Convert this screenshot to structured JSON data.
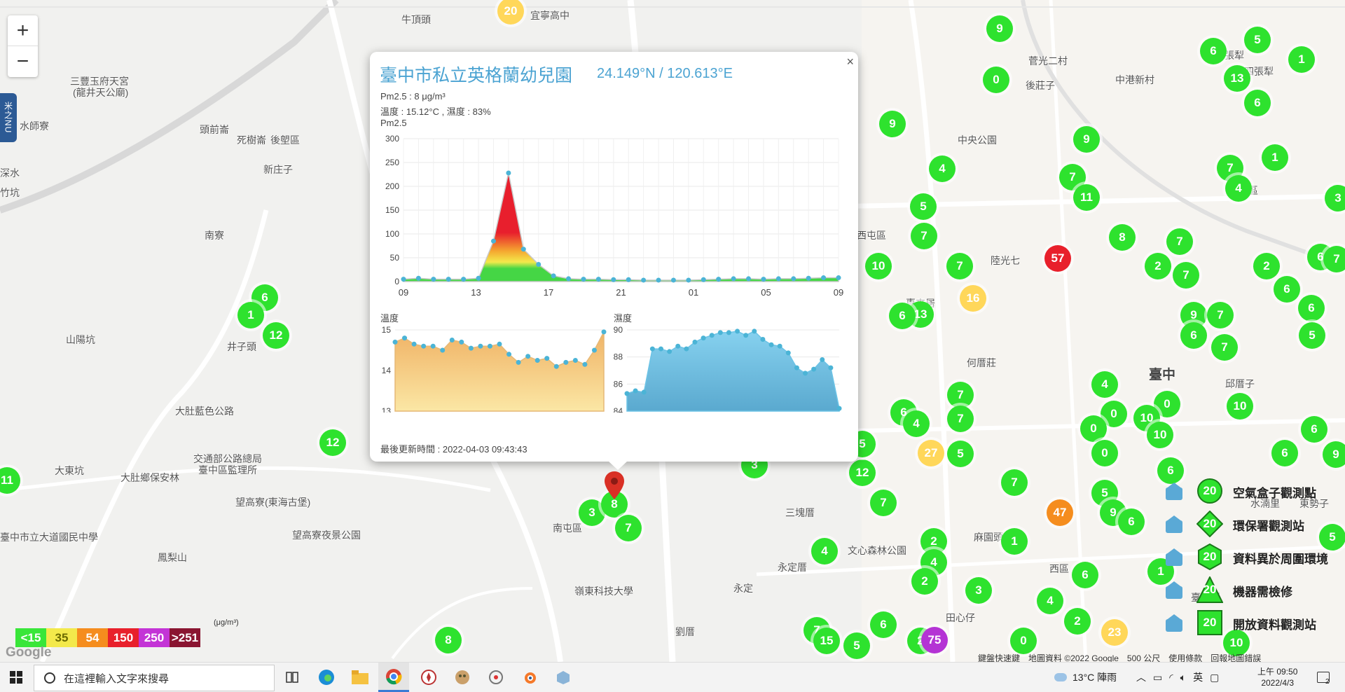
{
  "map": {
    "zoom_in": "+",
    "zoom_out": "−",
    "side_tab": "米之NU",
    "places": [
      {
        "text": "牛頂頭",
        "x": 573,
        "y": 18
      },
      {
        "text": "宜寧高中",
        "x": 757,
        "y": 12
      },
      {
        "text": "三豐玉府天宮",
        "x": 100,
        "y": 106
      },
      {
        "text": "(龍井天公廟)",
        "x": 104,
        "y": 122
      },
      {
        "text": "水師寮",
        "x": 28,
        "y": 170
      },
      {
        "text": "頭前崙",
        "x": 285,
        "y": 175
      },
      {
        "text": "死樹崙",
        "x": 338,
        "y": 190
      },
      {
        "text": "後塱區",
        "x": 386,
        "y": 190
      },
      {
        "text": "新庄子",
        "x": 376,
        "y": 232
      },
      {
        "text": "深水",
        "x": 0,
        "y": 237
      },
      {
        "text": "竹坑",
        "x": 0,
        "y": 265
      },
      {
        "text": "南寮",
        "x": 292,
        "y": 326
      },
      {
        "text": "山陽坑",
        "x": 94,
        "y": 475
      },
      {
        "text": "井子頭",
        "x": 324,
        "y": 485
      },
      {
        "text": "大肚藍色公路",
        "x": 250,
        "y": 577
      },
      {
        "text": "交通部公路總局",
        "x": 276,
        "y": 645
      },
      {
        "text": "臺中區監理所",
        "x": 283,
        "y": 661
      },
      {
        "text": "大東坑",
        "x": 78,
        "y": 662
      },
      {
        "text": "大肚鄉保安林",
        "x": 172,
        "y": 672
      },
      {
        "text": "望高寮(東海古堡)",
        "x": 336,
        "y": 707
      },
      {
        "text": "臺中市立大道國民中學",
        "x": 0,
        "y": 757
      },
      {
        "text": "望高寮夜景公園",
        "x": 417,
        "y": 754
      },
      {
        "text": "鳳梨山",
        "x": 225,
        "y": 786
      },
      {
        "text": "西屯區",
        "x": 1223,
        "y": 326
      },
      {
        "text": "惠來居",
        "x": 1293,
        "y": 423
      },
      {
        "text": "何厝莊",
        "x": 1380,
        "y": 508
      },
      {
        "text": "陸光七",
        "x": 1414,
        "y": 362
      },
      {
        "text": "北屯區",
        "x": 1754,
        "y": 262
      },
      {
        "text": "臺中",
        "x": 1640,
        "y": 520,
        "big": true
      },
      {
        "text": "北區",
        "x": 1753,
        "y": 568
      },
      {
        "text": "邱厝子",
        "x": 1749,
        "y": 538
      },
      {
        "text": "南屯區",
        "x": 789,
        "y": 744
      },
      {
        "text": "三塊厝",
        "x": 1121,
        "y": 722
      },
      {
        "text": "麻園頭",
        "x": 1390,
        "y": 757
      },
      {
        "text": "永定厝",
        "x": 1110,
        "y": 800
      },
      {
        "text": "西區",
        "x": 1498,
        "y": 802
      },
      {
        "text": "永定",
        "x": 1047,
        "y": 830
      },
      {
        "text": "劉厝",
        "x": 964,
        "y": 892
      },
      {
        "text": "田心仔",
        "x": 1350,
        "y": 872
      },
      {
        "text": "後莊子",
        "x": 1464,
        "y": 112
      },
      {
        "text": "中央公園",
        "x": 1367,
        "y": 190
      },
      {
        "text": "上七張犁",
        "x": 1720,
        "y": 69
      },
      {
        "text": "中港新村",
        "x": 1592,
        "y": 104
      },
      {
        "text": "四張犁",
        "x": 1776,
        "y": 92
      },
      {
        "text": "菅光二村",
        "x": 1468,
        "y": 77
      },
      {
        "text": "文心森林公園",
        "x": 1210,
        "y": 776
      },
      {
        "text": "臺中區",
        "x": 1700,
        "y": 843
      },
      {
        "text": "嶺東科技大學",
        "x": 820,
        "y": 834
      },
      {
        "text": "水湳里",
        "x": 1785,
        "y": 709
      },
      {
        "text": "東勢子",
        "x": 1855,
        "y": 709
      }
    ],
    "markers": [
      {
        "v": "20",
        "x": 729,
        "y": 16,
        "c": "#ffd75a"
      },
      {
        "v": "9",
        "x": 1427,
        "y": 41,
        "c": "#2ee22e"
      },
      {
        "v": "0",
        "x": 1422,
        "y": 114,
        "c": "#2ee22e"
      },
      {
        "v": "9",
        "x": 1274,
        "y": 177,
        "c": "#2ee22e"
      },
      {
        "v": "9",
        "x": 1551,
        "y": 199,
        "c": "#2ee22e"
      },
      {
        "v": "4",
        "x": 1345,
        "y": 241,
        "c": "#2ee22e"
      },
      {
        "v": "7",
        "x": 1531,
        "y": 253,
        "c": "#2ee22e"
      },
      {
        "v": "11",
        "x": 1551,
        "y": 282,
        "c": "#2ee22e"
      },
      {
        "v": "5",
        "x": 1318,
        "y": 295,
        "c": "#2ee22e"
      },
      {
        "v": "7",
        "x": 1319,
        "y": 337,
        "c": "#2ee22e"
      },
      {
        "v": "8",
        "x": 1602,
        "y": 339,
        "c": "#2ee22e"
      },
      {
        "v": "57",
        "x": 1510,
        "y": 369,
        "c": "#e8202b"
      },
      {
        "v": "10",
        "x": 1254,
        "y": 380,
        "c": "#2ee22e"
      },
      {
        "v": "7",
        "x": 1370,
        "y": 380,
        "c": "#2ee22e"
      },
      {
        "v": "16",
        "x": 1389,
        "y": 426,
        "c": "#ffd75a"
      },
      {
        "v": "13",
        "x": 1314,
        "y": 449,
        "c": "#2ee22e"
      },
      {
        "v": "6",
        "x": 1288,
        "y": 451,
        "c": "#2ee22e"
      },
      {
        "v": "6",
        "x": 1732,
        "y": 73,
        "c": "#2ee22e"
      },
      {
        "v": "5",
        "x": 1795,
        "y": 57,
        "c": "#2ee22e"
      },
      {
        "v": "1",
        "x": 1858,
        "y": 85,
        "c": "#2ee22e"
      },
      {
        "v": "13",
        "x": 1766,
        "y": 112,
        "c": "#2ee22e"
      },
      {
        "v": "6",
        "x": 1795,
        "y": 147,
        "c": "#2ee22e"
      },
      {
        "v": "1",
        "x": 1820,
        "y": 225,
        "c": "#2ee22e"
      },
      {
        "v": "7",
        "x": 1756,
        "y": 240,
        "c": "#2ee22e"
      },
      {
        "v": "4",
        "x": 1768,
        "y": 269,
        "c": "#2ee22e"
      },
      {
        "v": "7",
        "x": 1684,
        "y": 345,
        "c": "#2ee22e"
      },
      {
        "v": "2",
        "x": 1653,
        "y": 380,
        "c": "#2ee22e"
      },
      {
        "v": "7",
        "x": 1693,
        "y": 393,
        "c": "#2ee22e"
      },
      {
        "v": "2",
        "x": 1808,
        "y": 380,
        "c": "#2ee22e"
      },
      {
        "v": "6",
        "x": 1837,
        "y": 413,
        "c": "#2ee22e"
      },
      {
        "v": "6",
        "x": 1885,
        "y": 367,
        "c": "#2ee22e"
      },
      {
        "v": "6",
        "x": 1872,
        "y": 440,
        "c": "#2ee22e"
      },
      {
        "v": "9",
        "x": 1704,
        "y": 450,
        "c": "#2ee22e"
      },
      {
        "v": "7",
        "x": 1742,
        "y": 450,
        "c": "#2ee22e"
      },
      {
        "v": "6",
        "x": 1704,
        "y": 479,
        "c": "#2ee22e"
      },
      {
        "v": "5",
        "x": 1873,
        "y": 479,
        "c": "#2ee22e"
      },
      {
        "v": "7",
        "x": 1748,
        "y": 496,
        "c": "#2ee22e"
      },
      {
        "v": "4",
        "x": 1577,
        "y": 549,
        "c": "#2ee22e"
      },
      {
        "v": "0",
        "x": 1666,
        "y": 577,
        "c": "#2ee22e"
      },
      {
        "v": "10",
        "x": 1770,
        "y": 580,
        "c": "#2ee22e"
      },
      {
        "v": "0",
        "x": 1590,
        "y": 591,
        "c": "#2ee22e"
      },
      {
        "v": "10",
        "x": 1637,
        "y": 597,
        "c": "#2ee22e"
      },
      {
        "v": "0",
        "x": 1561,
        "y": 612,
        "c": "#2ee22e"
      },
      {
        "v": "10",
        "x": 1656,
        "y": 621,
        "c": "#2ee22e"
      },
      {
        "v": "0",
        "x": 1577,
        "y": 647,
        "c": "#2ee22e"
      },
      {
        "v": "6",
        "x": 1876,
        "y": 613,
        "c": "#2ee22e"
      },
      {
        "v": "6",
        "x": 1834,
        "y": 647,
        "c": "#2ee22e"
      },
      {
        "v": "9",
        "x": 1907,
        "y": 649,
        "c": "#2ee22e"
      },
      {
        "v": "7",
        "x": 1371,
        "y": 564,
        "c": "#2ee22e"
      },
      {
        "v": "6",
        "x": 1290,
        "y": 589,
        "c": "#2ee22e"
      },
      {
        "v": "4",
        "x": 1308,
        "y": 605,
        "c": "#2ee22e"
      },
      {
        "v": "7",
        "x": 1371,
        "y": 598,
        "c": "#2ee22e"
      },
      {
        "v": "27",
        "x": 1329,
        "y": 647,
        "c": "#ffd75a"
      },
      {
        "v": "5",
        "x": 1371,
        "y": 648,
        "c": "#2ee22e"
      },
      {
        "v": "12",
        "x": 1231,
        "y": 675,
        "c": "#2ee22e"
      },
      {
        "v": "5",
        "x": 1231,
        "y": 634,
        "c": "#2ee22e"
      },
      {
        "v": "6",
        "x": 1671,
        "y": 672,
        "c": "#2ee22e"
      },
      {
        "v": "7",
        "x": 1448,
        "y": 689,
        "c": "#2ee22e"
      },
      {
        "v": "7",
        "x": 1261,
        "y": 718,
        "c": "#2ee22e"
      },
      {
        "v": "5",
        "x": 1577,
        "y": 704,
        "c": "#2ee22e"
      },
      {
        "v": "47",
        "x": 1513,
        "y": 732,
        "c": "#f58d1e"
      },
      {
        "v": "9",
        "x": 1589,
        "y": 732,
        "c": "#2ee22e"
      },
      {
        "v": "6",
        "x": 1615,
        "y": 745,
        "c": "#2ee22e"
      },
      {
        "v": "1",
        "x": 1448,
        "y": 773,
        "c": "#2ee22e"
      },
      {
        "v": "2",
        "x": 1333,
        "y": 773,
        "c": "#2ee22e"
      },
      {
        "v": "4",
        "x": 1333,
        "y": 803,
        "c": "#2ee22e"
      },
      {
        "v": "2",
        "x": 1320,
        "y": 830,
        "c": "#2ee22e"
      },
      {
        "v": "4",
        "x": 1177,
        "y": 787,
        "c": "#2ee22e"
      },
      {
        "v": "6",
        "x": 1549,
        "y": 821,
        "c": "#2ee22e"
      },
      {
        "v": "1",
        "x": 1657,
        "y": 816,
        "c": "#2ee22e"
      },
      {
        "v": "3",
        "x": 1397,
        "y": 843,
        "c": "#2ee22e"
      },
      {
        "v": "4",
        "x": 1499,
        "y": 858,
        "c": "#2ee22e"
      },
      {
        "v": "2",
        "x": 1538,
        "y": 887,
        "c": "#2ee22e"
      },
      {
        "v": "23",
        "x": 1591,
        "y": 903,
        "c": "#ffd75a"
      },
      {
        "v": "10",
        "x": 1765,
        "y": 918,
        "c": "#2ee22e"
      },
      {
        "v": "5",
        "x": 1902,
        "y": 767,
        "c": "#2ee22e"
      },
      {
        "v": "6",
        "x": 1261,
        "y": 892,
        "c": "#2ee22e"
      },
      {
        "v": "2",
        "x": 1314,
        "y": 915,
        "c": "#2ee22e"
      },
      {
        "v": "75",
        "x": 1334,
        "y": 914,
        "c": "#b433d4"
      },
      {
        "v": "0",
        "x": 1461,
        "y": 915,
        "c": "#2ee22e"
      },
      {
        "v": "5",
        "x": 1223,
        "y": 922,
        "c": "#2ee22e"
      },
      {
        "v": "7",
        "x": 1166,
        "y": 900,
        "c": "#2ee22e"
      },
      {
        "v": "15",
        "x": 1180,
        "y": 915,
        "c": "#2ee22e"
      },
      {
        "v": "3",
        "x": 1077,
        "y": 664,
        "c": "#2ee22e"
      },
      {
        "v": "6",
        "x": 378,
        "y": 425,
        "c": "#2ee22e"
      },
      {
        "v": "1",
        "x": 358,
        "y": 450,
        "c": "#2ee22e"
      },
      {
        "v": "12",
        "x": 394,
        "y": 479,
        "c": "#2ee22e"
      },
      {
        "v": "12",
        "x": 475,
        "y": 632,
        "c": "#2ee22e"
      },
      {
        "v": "11",
        "x": 10,
        "y": 686,
        "c": "#2ee22e"
      },
      {
        "v": "3",
        "x": 845,
        "y": 732,
        "c": "#2ee22e"
      },
      {
        "v": "8",
        "x": 877,
        "y": 720,
        "c": "#2ee22e"
      },
      {
        "v": "7",
        "x": 897,
        "y": 754,
        "c": "#2ee22e"
      },
      {
        "v": "8",
        "x": 640,
        "y": 914,
        "c": "#2ee22e"
      },
      {
        "v": "3",
        "x": 1910,
        "y": 283,
        "c": "#2ee22e"
      },
      {
        "v": "7",
        "x": 1908,
        "y": 370,
        "c": "#2ee22e"
      }
    ],
    "legend": [
      {
        "label": "<15",
        "color": "#39e639"
      },
      {
        "label": "35",
        "color": "#f3e94b"
      },
      {
        "label": "54",
        "color": "#f58d1e"
      },
      {
        "label": "150",
        "color": "#e8202b"
      },
      {
        "label": "250",
        "color": "#c334d6"
      },
      {
        "label": ">251",
        "color": "#8a1531"
      }
    ],
    "legend_unit": "(μg/m³)",
    "google_logo": "Google",
    "attribution": [
      "鍵盤快速鍵",
      "地圖資料 ©2022 Google",
      "500 公尺",
      "使用條款",
      "回報地圖錯誤"
    ],
    "keys": [
      {
        "label": "空氣盒子觀測點",
        "value": "20",
        "shape": "circle"
      },
      {
        "label": "環保署觀測站",
        "value": "20",
        "shape": "diamond"
      },
      {
        "label": "資料異於周圍環境",
        "value": "20",
        "shape": "hexagon"
      },
      {
        "label": "機器需檢修",
        "value": "20",
        "shape": "triangle"
      },
      {
        "label": "開放資料觀測站",
        "value": "20",
        "shape": "square"
      }
    ]
  },
  "popup": {
    "title": "臺中市私立英格蘭幼兒園",
    "coord": "24.149°N / 120.613°E",
    "pm_line": "Pm2.5 : 8 μg/m³",
    "th_line": "溫度 : 15.12°C , 濕度 : 83%",
    "chart_label": "Pm2.5",
    "temp_label": "溫度",
    "hum_label": "濕度",
    "updated": "最後更新時間 : 2022-04-03 09:43:43",
    "close": "×"
  },
  "chart_data": [
    {
      "type": "area",
      "title": "Pm2.5",
      "x_ticks": [
        "09",
        "13",
        "17",
        "21",
        "01",
        "05",
        "09"
      ],
      "ylim": [
        0,
        300
      ],
      "y_ticks": [
        0,
        50,
        100,
        150,
        200,
        250,
        300
      ],
      "values": [
        5,
        7,
        5,
        5,
        5,
        7,
        85,
        228,
        68,
        36,
        12,
        6,
        5,
        5,
        4,
        4,
        3,
        3,
        3,
        3,
        4,
        5,
        6,
        6,
        5,
        6,
        6,
        7,
        8,
        8
      ]
    },
    {
      "type": "area",
      "title": "溫度",
      "ylim": [
        13,
        15
      ],
      "y_ticks": [
        13,
        14,
        15
      ],
      "values": [
        14.7,
        14.8,
        14.65,
        14.6,
        14.6,
        14.5,
        14.75,
        14.7,
        14.55,
        14.6,
        14.6,
        14.65,
        14.4,
        14.2,
        14.35,
        14.25,
        14.3,
        14.1,
        14.2,
        14.25,
        14.15,
        14.5,
        14.95
      ]
    },
    {
      "type": "area",
      "title": "濕度",
      "ylim": [
        84,
        90
      ],
      "y_ticks": [
        84,
        86,
        88,
        90
      ],
      "values": [
        85.3,
        85.5,
        85.4,
        88.6,
        88.6,
        88.4,
        88.8,
        88.6,
        89.1,
        89.4,
        89.6,
        89.8,
        89.8,
        89.9,
        89.6,
        89.9,
        89.3,
        88.9,
        88.8,
        88.3,
        87.2,
        86.8,
        87.1,
        87.8,
        87.2,
        84.2
      ]
    }
  ],
  "taskbar": {
    "search_placeholder": "在這裡輸入文字來搜尋",
    "weather": "13°C  陣雨",
    "ime": "英",
    "time": "上午 09:50",
    "date": "2022/4/3",
    "notif_count": "2"
  }
}
